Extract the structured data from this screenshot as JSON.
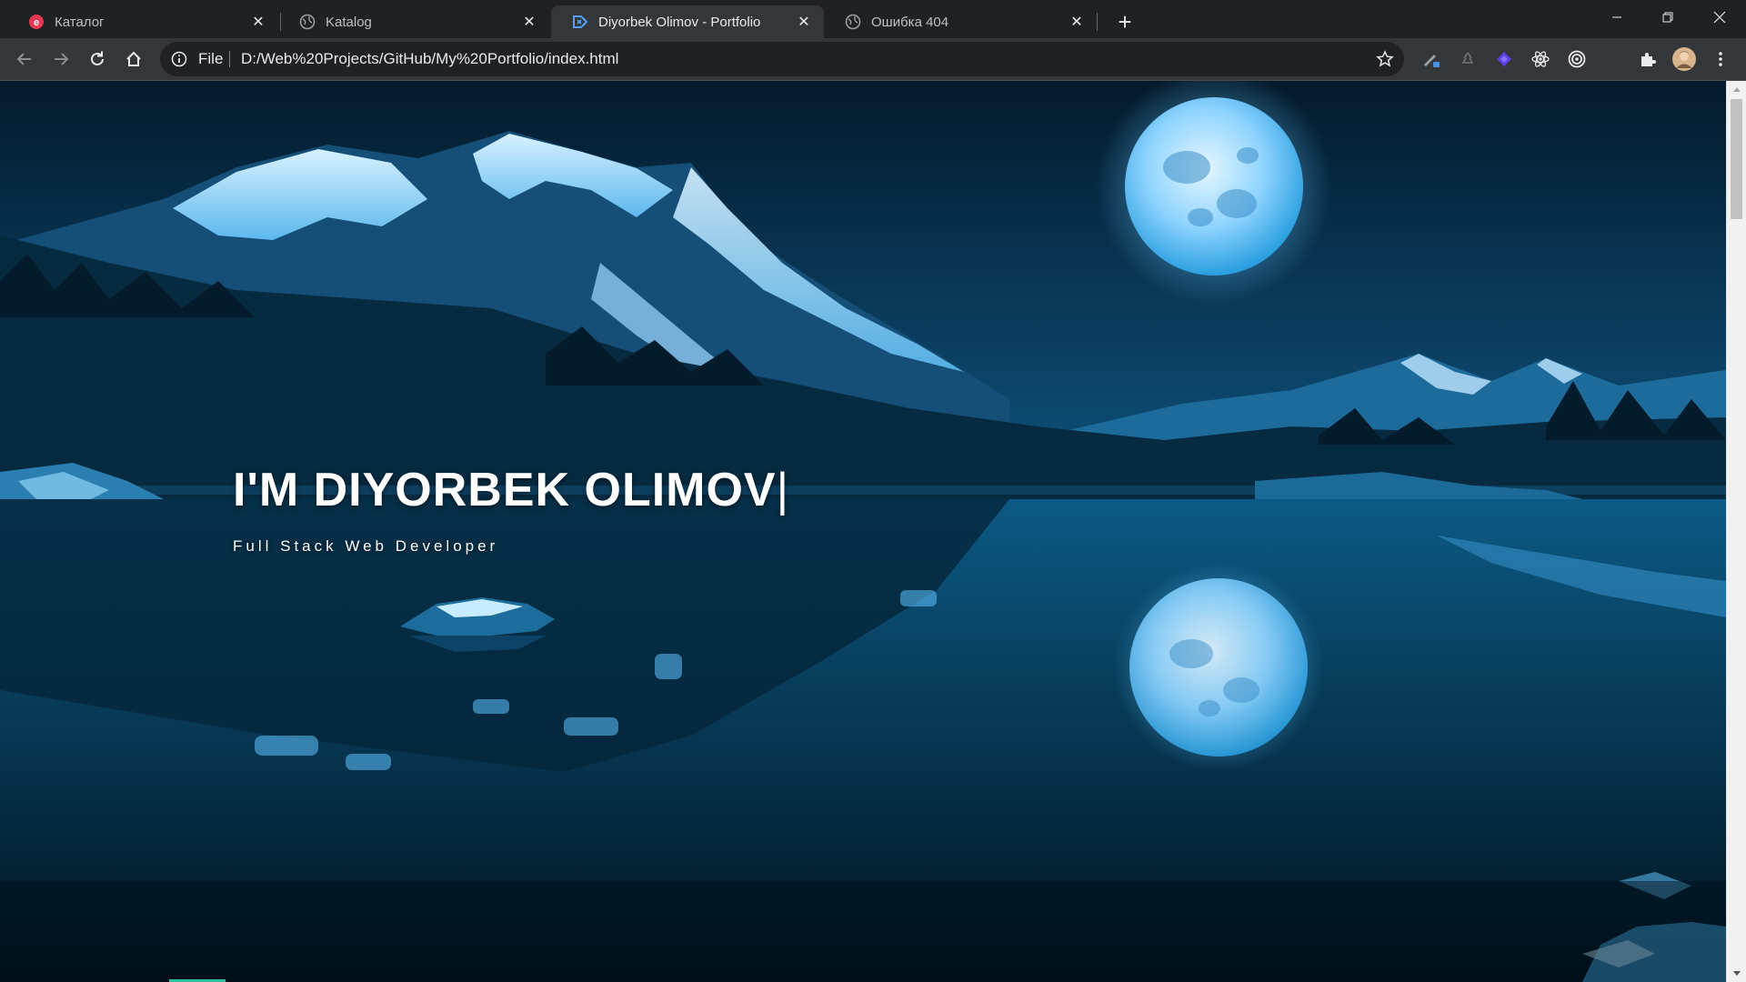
{
  "browser": {
    "tabs": [
      {
        "title": "Каталог",
        "favicon": "red-brand-icon",
        "active": false
      },
      {
        "title": "Katalog",
        "favicon": "globe-icon",
        "active": false
      },
      {
        "title": "Diyorbek Olimov - Portfolio",
        "favicon": "code-logo-icon",
        "active": true
      },
      {
        "title": "Ошибка 404",
        "favicon": "globe-icon",
        "active": false
      }
    ],
    "omnibox": {
      "scheme_label": "File",
      "url": "D:/Web%20Projects/GitHub/My%20Portfolio/index.html"
    },
    "extensions": [
      "pen-extension-icon",
      "recycle-extension-icon",
      "purple-gem-extension-icon",
      "react-atom-extension-icon",
      "target-extension-icon",
      "puzzle-icon",
      "profile-avatar",
      "kebab-menu-icon"
    ]
  },
  "page": {
    "hero": {
      "title": "I'M DIYORBEK OLIMOV",
      "cursor": "|",
      "subtitle": "Full Stack Web Developer"
    },
    "colors": {
      "sky": "#0a3a5a",
      "water": "#063048",
      "accent": "#2bbf9e",
      "moon": "#bfe8ff"
    }
  }
}
